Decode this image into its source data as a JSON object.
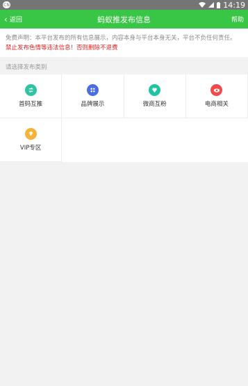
{
  "status_bar": {
    "time": "14:19"
  },
  "nav": {
    "back_label": "返回",
    "title": "蚂蚁推发布信息",
    "help_label": "帮助"
  },
  "notice": {
    "desc": "免费声明：本平台发布的所有信息展示，内容本身与平台本身无关，平台不负任何责任。",
    "warning": "禁止发布色情等违法信息！否则删除不退费"
  },
  "section_label": "请选择发布类别",
  "categories": [
    {
      "label": "首码互推",
      "icon": "swap-arrows-icon",
      "color": "#2fc3a0"
    },
    {
      "label": "品牌展示",
      "icon": "dots-grid-icon",
      "color": "#4a6ee0"
    },
    {
      "label": "微商互粉",
      "icon": "heart-drop-icon",
      "color": "#22c3a5"
    },
    {
      "label": "电商相关",
      "icon": "eye-icon",
      "color": "#f04a4a"
    },
    {
      "label": "VIP专区",
      "icon": "diamond-icon",
      "color": "#f5b33b"
    }
  ]
}
